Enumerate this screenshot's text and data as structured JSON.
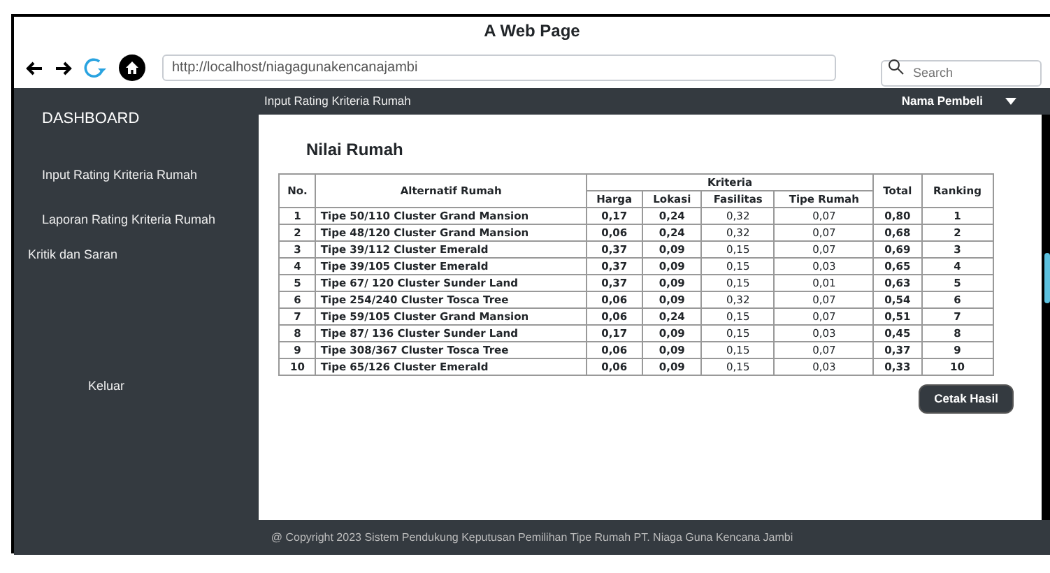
{
  "browser": {
    "title": "A Web Page",
    "url": "http://localhost/niagagunakencanajambi",
    "search": {
      "placeholder": "Search"
    }
  },
  "sidebar": {
    "brand": "DASHBOARD",
    "items": [
      {
        "label": "Input Rating Kriteria Rumah",
        "selected": false
      },
      {
        "label": "Laporan Rating Kriteria Rumah",
        "selected": false
      },
      {
        "label": "Kritik dan Saran",
        "selected": false
      }
    ],
    "logout": "Keluar"
  },
  "topbar": {
    "breadcrumb": "Input Rating Kriteria Rumah",
    "user": "Nama Pembeli"
  },
  "panel": {
    "heading": "Nilai Rumah",
    "table": {
      "group_header": "Kriteria",
      "columns": [
        "No.",
        "Alternatif Rumah",
        "Harga",
        "Lokasi",
        "Fasilitas",
        "Tipe Rumah",
        "Total",
        "Ranking"
      ],
      "rows": [
        [
          "1",
          "Tipe 50/110 Cluster Grand Mansion",
          "0,17",
          "0,24",
          "0,32",
          "0,07",
          "0,80",
          "1"
        ],
        [
          "2",
          "Tipe 48/120 Cluster Grand Mansion",
          "0,06",
          "0,24",
          "0,32",
          "0,07",
          "0,68",
          "2"
        ],
        [
          "3",
          "Tipe 39/112 Cluster Emerald",
          "0,37",
          "0,09",
          "0,15",
          "0,07",
          "0,69",
          "3"
        ],
        [
          "4",
          "Tipe 39/105 Cluster Emerald",
          "0,37",
          "0,09",
          "0,15",
          "0,03",
          "0,65",
          "4"
        ],
        [
          "5",
          "Tipe 67/ 120 Cluster Sunder Land",
          "0,37",
          "0,09",
          "0,15",
          "0,01",
          "0,63",
          "5"
        ],
        [
          "6",
          "Tipe 254/240 Cluster Tosca Tree",
          "0,06",
          "0,09",
          "0,32",
          "0,07",
          "0,54",
          "6"
        ],
        [
          "7",
          "Tipe 59/105 Cluster Grand Mansion",
          "0,06",
          "0,24",
          "0,15",
          "0,07",
          "0,51",
          "7"
        ],
        [
          "8",
          "Tipe 87/ 136 Cluster Sunder Land",
          "0,17",
          "0,09",
          "0,15",
          "0,03",
          "0,45",
          "8"
        ],
        [
          "9",
          "Tipe 308/367 Cluster Tosca Tree",
          "0,06",
          "0,09",
          "0,15",
          "0,07",
          "0,37",
          "9"
        ],
        [
          "10",
          "Tipe 65/126 Cluster Emerald",
          "0,06",
          "0,09",
          "0,15",
          "0,03",
          "0,33",
          "10"
        ]
      ]
    },
    "button": "Cetak Hasil"
  },
  "footer": "@ Copyright 2023 Sistem Pendukung Keputusan Pemilihan Tipe Rumah PT. Niaga Guna Kencana Jambi"
}
